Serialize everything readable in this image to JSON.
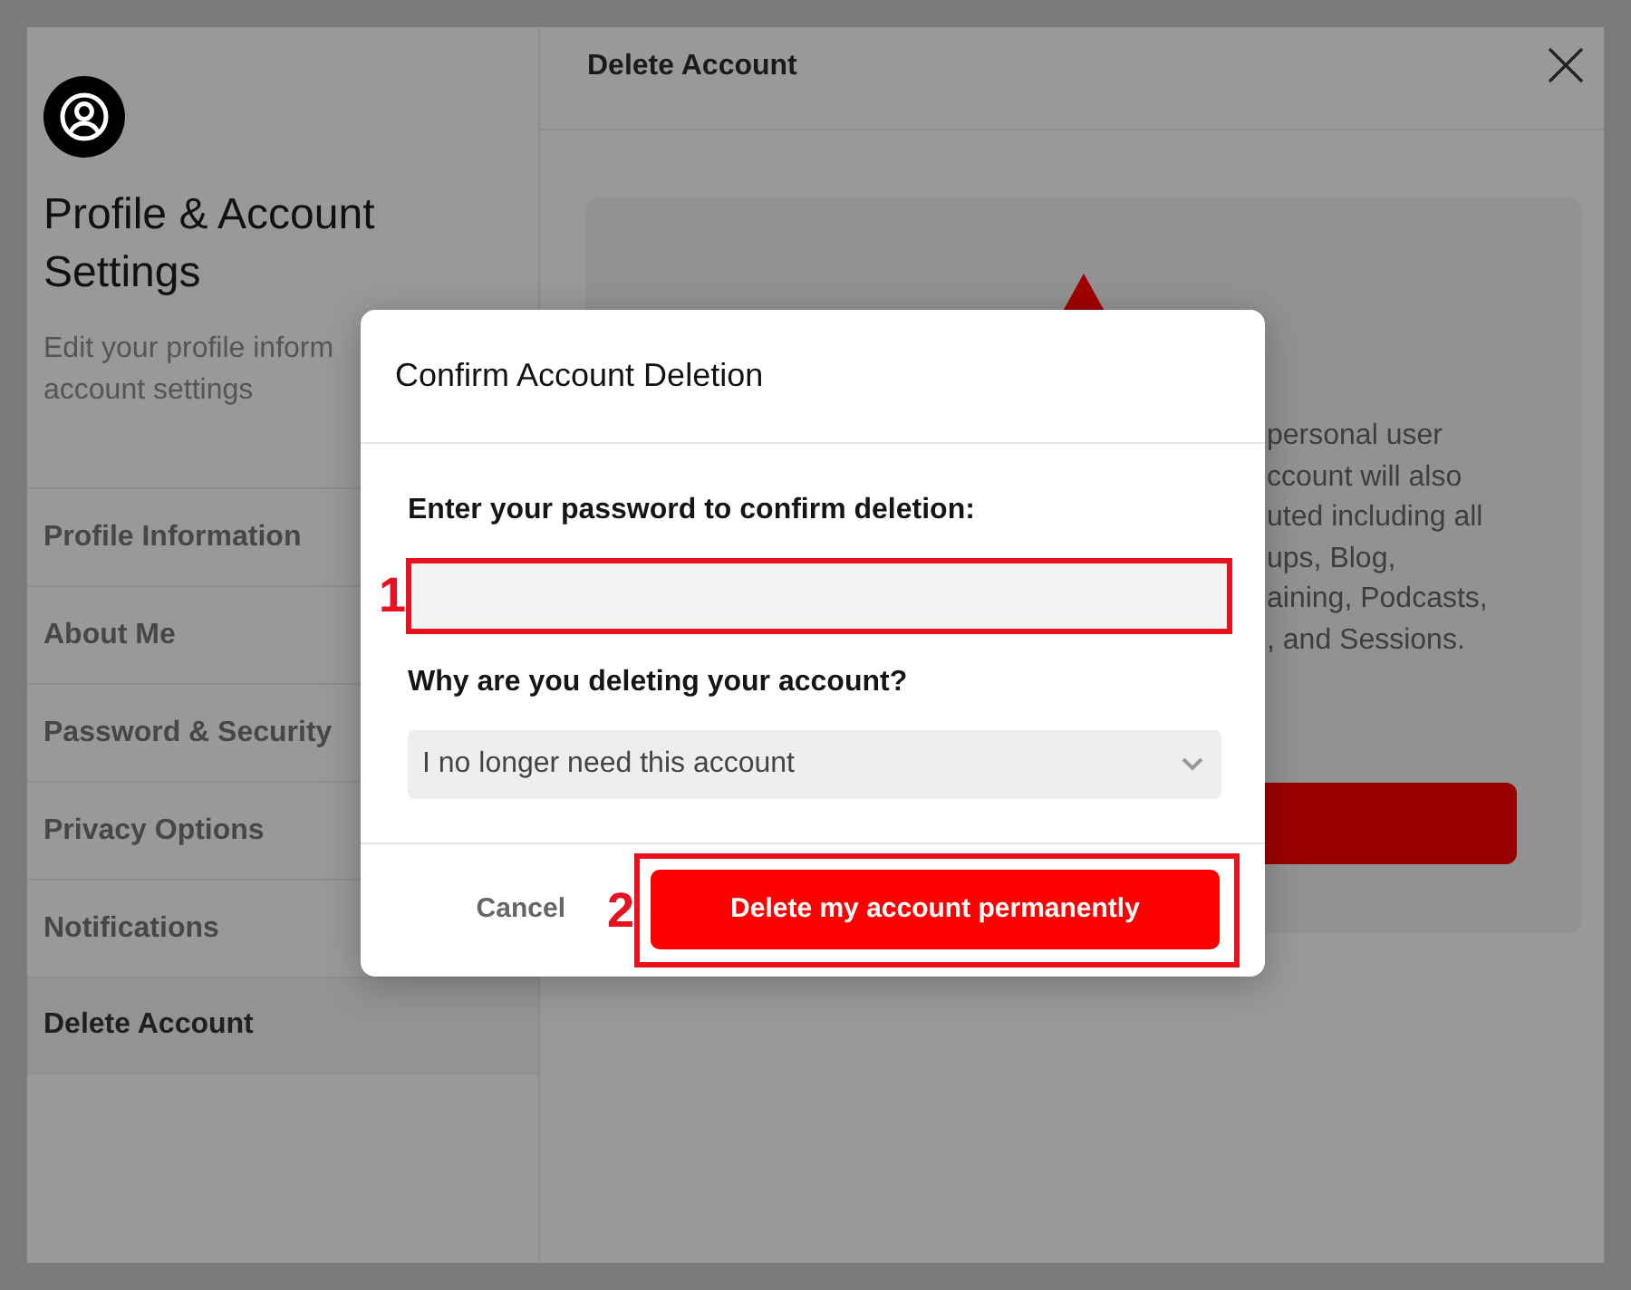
{
  "sidebar": {
    "title": "Profile & Account Settings",
    "description_lines": [
      "Edit your profile inform",
      "account settings"
    ],
    "items": [
      {
        "label": "Profile Information",
        "selected": false
      },
      {
        "label": "About Me",
        "selected": false
      },
      {
        "label": "Password & Security",
        "selected": false
      },
      {
        "label": "Privacy Options",
        "selected": false
      },
      {
        "label": "Notifications",
        "selected": false
      },
      {
        "label": "Delete Account",
        "selected": true
      }
    ]
  },
  "content": {
    "title": "Delete Account",
    "warning_lines": [
      "personal user",
      "ccount will also",
      "uted including all",
      "ups, Blog,",
      "aining, Podcasts,",
      ", and Sessions."
    ]
  },
  "dialog": {
    "title": "Confirm Account Deletion",
    "password_label": "Enter your password to confirm deletion:",
    "password_field": {
      "annotation": "1"
    },
    "reason_label": "Why are you deleting your account?",
    "reason_select": {
      "value": "I no longer need this account"
    },
    "cancel_label": "Cancel",
    "confirm_button": {
      "label": "Delete my account permanently",
      "annotation": "2"
    }
  }
}
